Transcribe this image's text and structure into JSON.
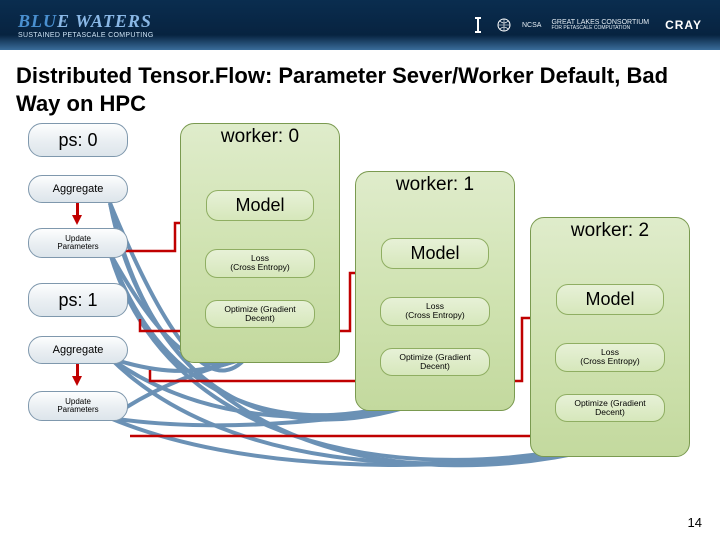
{
  "header": {
    "logo_blue": "BLU",
    "logo_rest": "E WATERS",
    "tagline": "SUSTAINED PETASCALE COMPUTING",
    "partners": {
      "illinois_icon": "I",
      "ncsa": "NCSA",
      "consortium_line1": "GREAT LAKES CONSORTIUM",
      "consortium_line2": "FOR PETASCALE COMPUTATION",
      "cray": "CRAY"
    }
  },
  "title": "Distributed Tensor.Flow: Parameter Sever/Worker Default, Bad Way on HPC",
  "ps0": {
    "label": "ps: 0",
    "aggregate": "Aggregate",
    "update": "Update\nParameters"
  },
  "ps1": {
    "label": "ps: 1",
    "aggregate": "Aggregate",
    "update": "Update\nParameters"
  },
  "worker0": {
    "title": "worker: 0",
    "model": "Model",
    "loss": "Loss\n(Cross Entropy)",
    "optimize": "Optimize (Gradient\nDecent)"
  },
  "worker1": {
    "title": "worker: 1",
    "model": "Model",
    "loss": "Loss\n(Cross Entropy)",
    "optimize": "Optimize (Gradient\nDecent)"
  },
  "worker2": {
    "title": "worker: 2",
    "model": "Model",
    "loss": "Loss\n(Cross Entropy)",
    "optimize": "Optimize (Gradient\nDecent)"
  },
  "page_number": "14",
  "colors": {
    "wire_blue": "#6b91b5",
    "wire_red": "#c00000",
    "ps_fill_top": "#fdfefe",
    "ps_stroke": "#7f98ad",
    "worker_fill": "#dfeccb",
    "worker_stroke": "#7a9a50"
  }
}
